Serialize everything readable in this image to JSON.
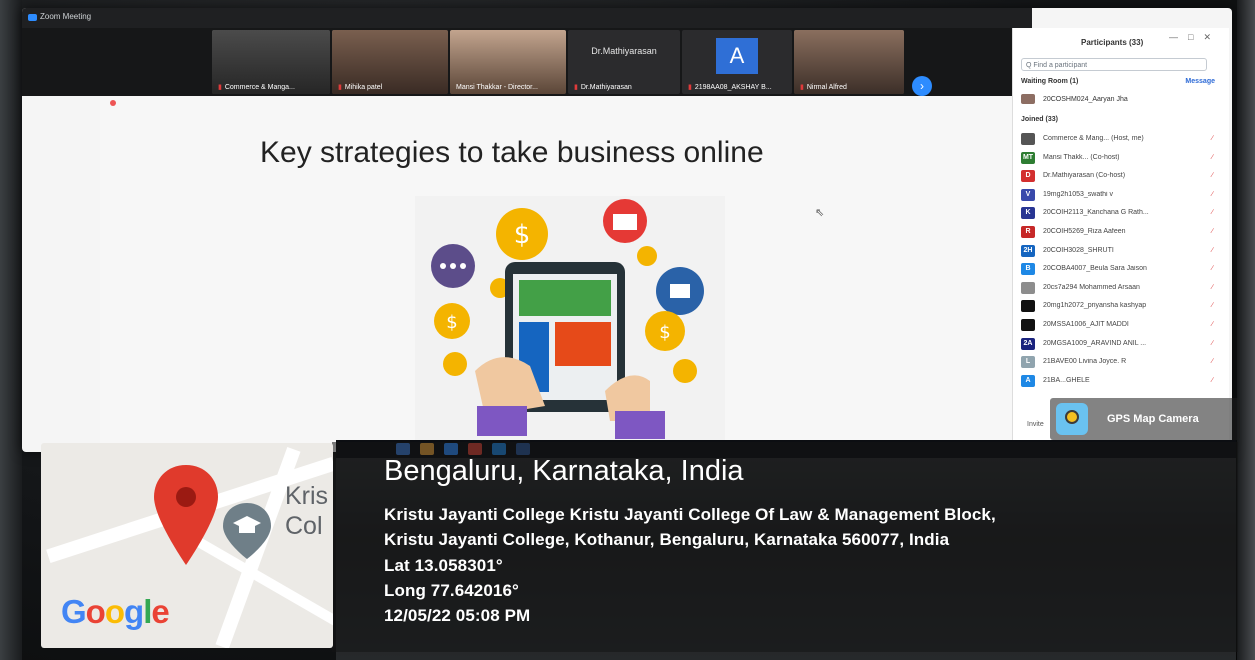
{
  "zoom": {
    "window_title": "Zoom Meeting",
    "video_tiles": [
      {
        "name": "Commerce & Manga..."
      },
      {
        "name": "Mihika patel"
      },
      {
        "name": "Mansi Thakkar - Director..."
      },
      {
        "name": "Dr.Mathiyarasan",
        "top_text": "Dr.Mathiyarasan"
      },
      {
        "name": "2198AA08_AKSHAY B...",
        "letter": "A"
      },
      {
        "name": "Nirmal Alfred"
      }
    ]
  },
  "slide": {
    "title": "Key strategies to take business online"
  },
  "participants": {
    "title": "Participants (33)",
    "search_placeholder": "Q Find a participant",
    "waiting_room": "Waiting Room (1)",
    "message_label": "Message",
    "waiting_member": "20COSHM024_Aaryan Jha",
    "joined_label": "Joined (33)",
    "invite_label": "Invite",
    "list": [
      {
        "av": "",
        "color": "#555555",
        "name": "Commerce & Mang... (Host, me)"
      },
      {
        "av": "MT",
        "color": "#2e7d32",
        "name": "Mansi Thakk... (Co-host)"
      },
      {
        "av": "D",
        "color": "#d32f2f",
        "name": "Dr.Mathiyarasan (Co-host)"
      },
      {
        "av": "V",
        "color": "#3949ab",
        "name": "19mg2h1053_swathi v"
      },
      {
        "av": "K",
        "color": "#283593",
        "name": "20COIH2113_Kanchana G Rath..."
      },
      {
        "av": "R",
        "color": "#c62828",
        "name": "20COIH5269_Riza Aafeen"
      },
      {
        "av": "2H",
        "color": "#1565c0",
        "name": "20COIH3028_SHRUTI"
      },
      {
        "av": "B",
        "color": "#1e88e5",
        "name": "20COBA4007_Beula Sara Jaison"
      },
      {
        "av": "",
        "color": "#8d8d8d",
        "name": "20cs7a294 Mohammed Arsaan"
      },
      {
        "av": "",
        "color": "#111111",
        "name": "20mg1h2072_priyansha kashyap"
      },
      {
        "av": "",
        "color": "#111111",
        "name": "20MSSA1006_AJIT MADDI"
      },
      {
        "av": "2A",
        "color": "#1a237e",
        "name": "20MGSA1009_ARAVIND ANIL ..."
      },
      {
        "av": "L",
        "color": "#90a4ae",
        "name": "21BAVE00 Livina Joyce. R"
      },
      {
        "av": "A",
        "color": "#1e88e5",
        "name": "21BA...GHELE"
      }
    ]
  },
  "gps_badge": {
    "label": "GPS Map Camera"
  },
  "map": {
    "place_label": "Kris\nCol",
    "google": "Google"
  },
  "location": {
    "city": "Bengaluru, Karnataka, India",
    "address_line1": "Kristu Jayanti College Kristu Jayanti College Of Law & Management Block,",
    "address_line2": "Kristu Jayanti College, Kothanur, Bengaluru, Karnataka 560077, India",
    "lat": "Lat 13.058301°",
    "long": "Long 77.642016°",
    "datetime": "12/05/22 05:08 PM"
  },
  "colors": {
    "zoom_blue": "#2d8cff",
    "pin_red": "#ea4335",
    "google_blue": "#4285f4",
    "google_red": "#ea4335",
    "google_yellow": "#fbbc05",
    "google_green": "#34a853"
  }
}
